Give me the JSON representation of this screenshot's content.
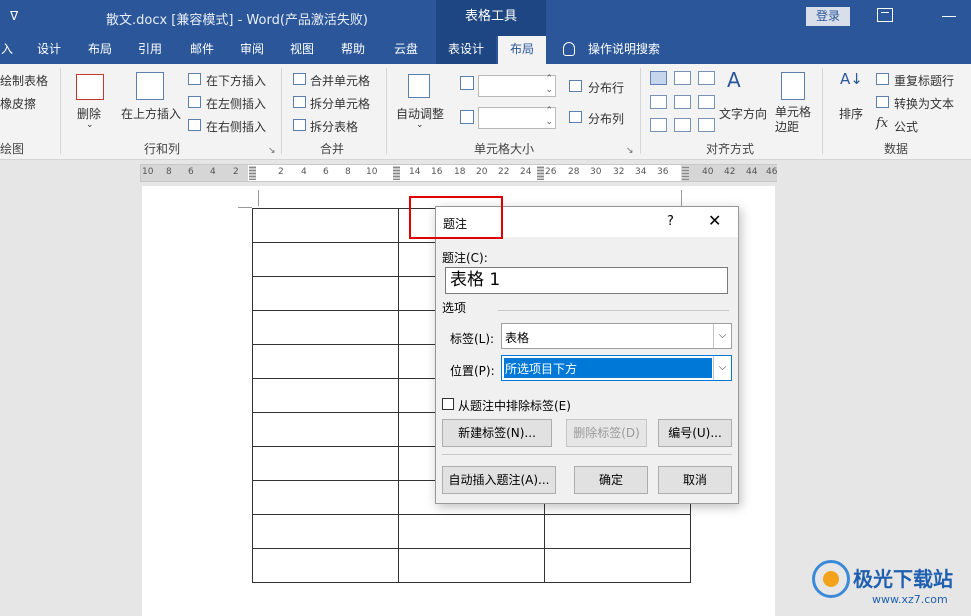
{
  "titlebar": {
    "qat": "ᐁ",
    "title": "散文.docx [兼容模式]  -  Word(产品激活失败)",
    "context_tab_group": "表格工具",
    "login": "登录"
  },
  "tabs": [
    {
      "label": "入"
    },
    {
      "label": "设计"
    },
    {
      "label": "布局"
    },
    {
      "label": "引用"
    },
    {
      "label": "邮件"
    },
    {
      "label": "审阅"
    },
    {
      "label": "视图"
    },
    {
      "label": "帮助"
    },
    {
      "label": "云盘"
    },
    {
      "label": "表设计"
    },
    {
      "label": "布局"
    },
    {
      "label": "操作说明搜索"
    }
  ],
  "ribbon": {
    "draw": {
      "draw_table": "绘制表格",
      "eraser": "橡皮擦",
      "group": "绘图"
    },
    "rows_cols": {
      "delete": "删除",
      "insert_above": "在上方插入",
      "insert_below": "在下方插入",
      "insert_left": "在左侧插入",
      "insert_right": "在右侧插入",
      "group": "行和列"
    },
    "merge": {
      "merge_cells": "合并单元格",
      "split_cells": "拆分单元格",
      "split_table": "拆分表格",
      "group": "合并"
    },
    "cell_size": {
      "autofit": "自动调整",
      "distribute_rows": "分布行",
      "distribute_cols": "分布列",
      "group": "单元格大小"
    },
    "alignment": {
      "text_direction": "文字方向",
      "cell_margins": "单元格边距",
      "group": "对齐方式"
    },
    "data": {
      "sort": "排序",
      "repeat_header": "重复标题行",
      "convert_text": "转换为文本",
      "formula": "公式",
      "group": "数据"
    },
    "launcher_glyph": "↘"
  },
  "ruler": [
    "10",
    "8",
    "6",
    "4",
    "2",
    "2",
    "4",
    "6",
    "8",
    "10",
    "14",
    "16",
    "18",
    "20",
    "22",
    "24",
    "26",
    "28",
    "30",
    "32",
    "34",
    "36",
    "40",
    "42",
    "44",
    "46"
  ],
  "dialog": {
    "title": "题注",
    "help": "?",
    "close": "✕",
    "caption_label": "题注(C):",
    "caption_value": "表格  1",
    "options_label": "选项",
    "label_label": "标签(L):",
    "label_value": "表格",
    "position_label": "位置(P):",
    "position_value": "所选项目下方",
    "exclude_label": "从题注中排除标签(E)",
    "new_label_btn": "新建标签(N)...",
    "delete_label_btn": "删除标签(D)",
    "numbering_btn": "编号(U)...",
    "autocaption_btn": "自动插入题注(A)...",
    "ok_btn": "确定",
    "cancel_btn": "取消"
  },
  "watermark": {
    "name": "极光下载站",
    "url": "www.xz7.com"
  }
}
